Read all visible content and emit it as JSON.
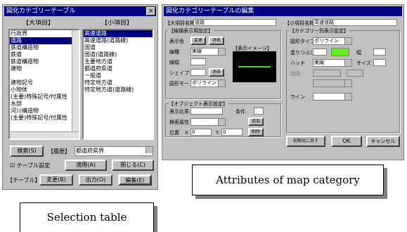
{
  "left_window": {
    "title": "図化カテゴリーテーブル",
    "close": "×",
    "major_header": "【大項目】",
    "minor_header": "【小項目】",
    "major_items": [
      "行政界",
      "道路",
      "鉄道構造物",
      "鉄道",
      "鉄道構造物",
      "建物",
      "",
      "建物記号",
      "小物体",
      "(主要)特殊記号/付属性",
      "水部",
      "河川構造物",
      "(主要)特殊記号/付属性"
    ],
    "minor_items": [
      "高速道路",
      "高速道路(道路線)",
      "国道",
      "国道(道路線)",
      "主要地方道",
      "都道府県道",
      "一般道",
      "特定地方道",
      "特定地方道(道路線)"
    ],
    "search_btn": "検索(S)",
    "history_label": "【履歴】",
    "history_value": "都道府県界",
    "table_settings": "テーブル設定",
    "apply_btn": "適用(A)",
    "close_btn": "閉じる(C)",
    "table_tag": "【テーブル】",
    "change_btn": "変更(B)",
    "output_btn": "出力(O)",
    "edit_btn": "編集(E)"
  },
  "right_window": {
    "title": "図化カテゴリーテーブルの編集",
    "major_label": "【大項目名称】",
    "major_value": "道路",
    "minor_label": "【小項目名称】",
    "minor_value": "高速道路",
    "display_group": "【線描表示用設定】",
    "line_label": "表示色",
    "color_btn": "変更",
    "color_btn2": "消去",
    "type_label": "線種",
    "type_value": "実線",
    "width_label": "線幅",
    "arrow_label": "シェイプ",
    "mode_label": "図形モード",
    "mode_value": "ポリライン",
    "preview_label": "【表示イメージ】",
    "color_group": "【カテゴリー別表示設定】",
    "shape_type_label": "図形タイプ",
    "shape_type_value": "ポリライン",
    "fill_label": "塗りつぶし色",
    "fill_color": "#66ee22",
    "hatch_label": "ハッチ",
    "hatch_value": "実線",
    "width2_label": "幅",
    "size_label": "サイズ",
    "spacing_label": "間隔",
    "line2_label": "ライン",
    "sub_group": "【オブジェクト表示設定】",
    "scale_label": "表示比率",
    "cond_label": "条件",
    "attr_label": "検索属性",
    "add_btn": "追加",
    "delete_btn": "削除",
    "pos_label": "位置",
    "x_label": "X",
    "x_value": "0",
    "y_label": "Y",
    "y_value": "0",
    "initial_btn": "初期化に戻す",
    "ok_btn": "OK",
    "cancel_btn": "キャンセル"
  },
  "captions": {
    "selection": "Selection table",
    "attributes": "Attributes of map category"
  }
}
